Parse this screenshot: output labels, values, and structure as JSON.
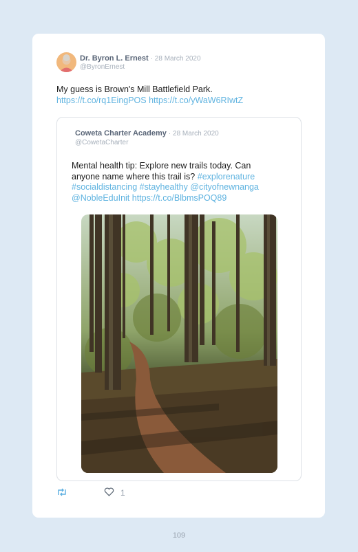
{
  "tweet": {
    "author_name": "Dr. Byron L. Ernest",
    "date": "· 28 March 2020",
    "handle": "@ByronErnest",
    "text": "My guess is Brown's Mill Battlefield Park.",
    "links": "https://t.co/rq1EingPOS https://t.co/yWaW6RIwtZ"
  },
  "quoted_tweet": {
    "author_name": "Coweta Charter Academy",
    "date": "· 28 March 2020",
    "handle": "@CowetaCharter",
    "text": "Mental health tip: Explore new trails today. Can anyone name where this trail is?",
    "tags_1": "#explorenature",
    "tags_2": "#socialdistancing #stayhealthy @cityofnewnanga",
    "tags_3": "@NobleEduInit https://t.co/BlbmsPOQ89"
  },
  "actions": {
    "retweet_icon": "retweet-icon",
    "like_icon": "heart-icon",
    "like_count": "1"
  },
  "page_number": "109"
}
